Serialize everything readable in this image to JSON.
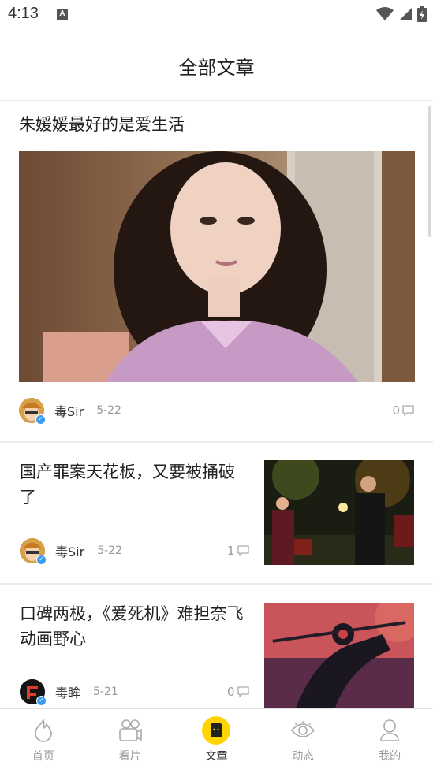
{
  "status": {
    "time": "4:13",
    "notification": "A"
  },
  "header": {
    "title": "全部文章"
  },
  "articles": [
    {
      "title": "朱媛媛最好的是爱生活",
      "author": "毒Sir",
      "date": "5-22",
      "comments": "0",
      "cover": "portrait-woman"
    },
    {
      "title": "国产罪案天花板，又要被捅破了",
      "author": "毒Sir",
      "date": "5-22",
      "comments": "1",
      "cover": "two-men-night"
    },
    {
      "title": "口碑两极，《爱死机》难担奈飞动画野心",
      "author": "毒眸",
      "date": "5-21",
      "comments": "0",
      "cover": "animated-warrior"
    }
  ],
  "tabs": [
    {
      "label": "首页",
      "icon": "fire-icon",
      "active": false
    },
    {
      "label": "看片",
      "icon": "camera-icon",
      "active": false
    },
    {
      "label": "文章",
      "icon": "article-icon",
      "active": true
    },
    {
      "label": "动态",
      "icon": "eye-icon",
      "active": false
    },
    {
      "label": "我的",
      "icon": "user-icon",
      "active": false
    }
  ],
  "colors": {
    "accent": "#ffd400",
    "verified": "#3b9cf0",
    "muted": "#999999"
  }
}
